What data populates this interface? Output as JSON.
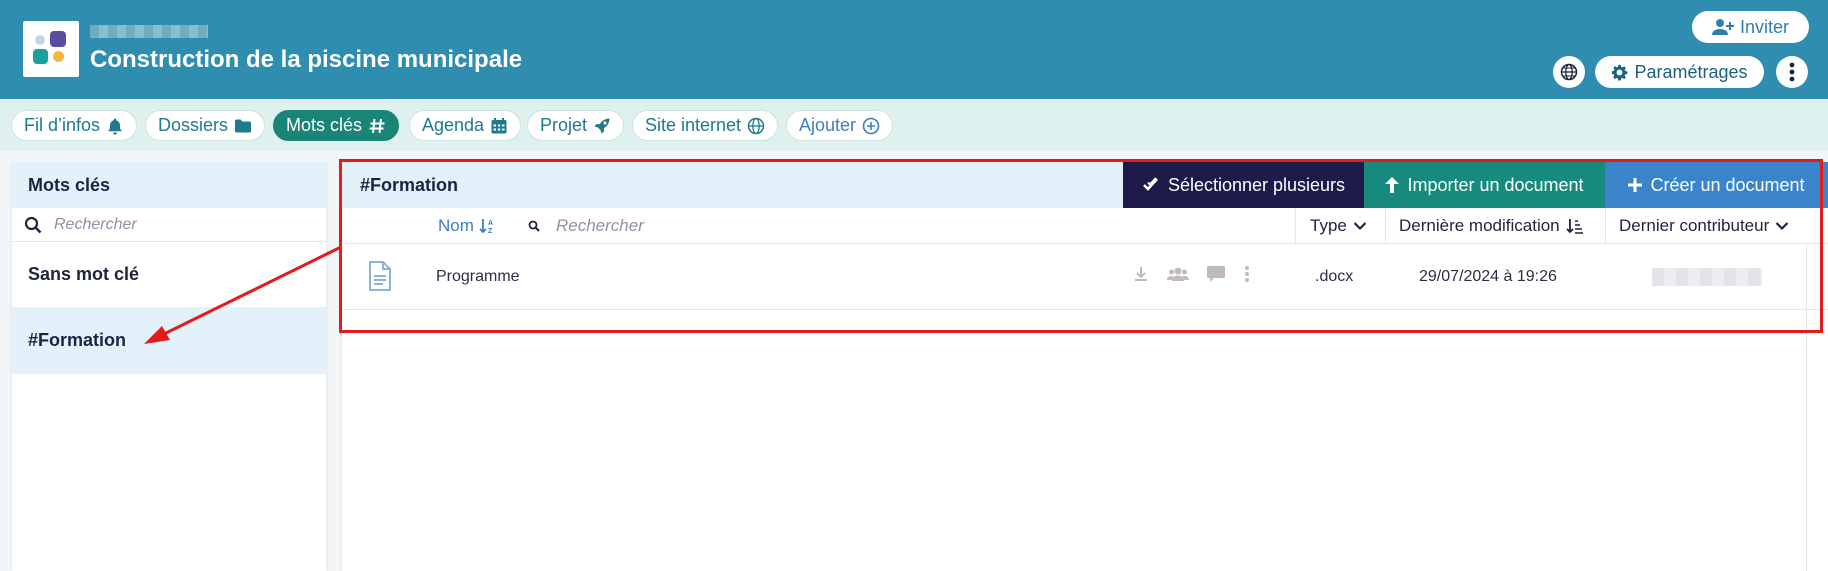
{
  "header": {
    "project_title": "Construction de la piscine municipale",
    "invite_label": "Inviter",
    "settings_label": "Paramétrages"
  },
  "nav": {
    "items": [
      {
        "label": "Fil d’infos",
        "icon": "bell-icon"
      },
      {
        "label": "Dossiers",
        "icon": "folder-icon"
      },
      {
        "label": "Mots clés",
        "icon": "hashtag-icon",
        "active": true
      },
      {
        "label": "Agenda",
        "icon": "calendar-icon"
      },
      {
        "label": "Projet",
        "icon": "rocket-icon"
      },
      {
        "label": "Site internet",
        "icon": "globe-icon"
      },
      {
        "label": "Ajouter",
        "icon": "plus-circle-icon"
      }
    ]
  },
  "sidebar": {
    "title": "Mots clés",
    "search_placeholder": "Rechercher",
    "items": [
      {
        "label": "Sans mot clé"
      },
      {
        "label": "#Formation",
        "active": true
      }
    ]
  },
  "main": {
    "title": "#Formation",
    "actions": {
      "select_multiple": "Sélectionner plusieurs",
      "import_document": "Importer un document",
      "create_document": "Créer un document"
    },
    "columns": {
      "name": "Nom",
      "search_placeholder": "Rechercher",
      "type": "Type",
      "last_modified": "Dernière modification",
      "last_contributor": "Dernier contributeur"
    },
    "rows": [
      {
        "name": "Programme",
        "type": ".docx",
        "modified": "29/07/2024 à 19:26"
      }
    ]
  },
  "colors": {
    "header_bg": "#2f8db0",
    "nav_bg": "#dff1ef",
    "active_tab": "#1a8577",
    "select_btn": "#1e1b4b",
    "import_btn": "#168a7c",
    "create_btn": "#3a84c9",
    "annotation": "#e31b1b"
  }
}
